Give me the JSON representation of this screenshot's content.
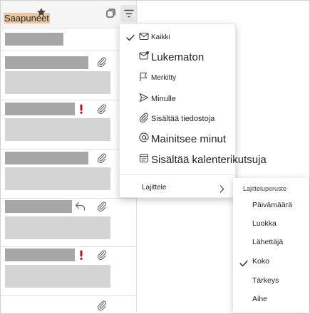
{
  "header": {
    "folder_title": "Saapuneet"
  },
  "filter_menu": {
    "items": [
      {
        "label": "Kaikki",
        "checked": true,
        "icon": "envelope-icon"
      },
      {
        "label": "Lukematon",
        "checked": false,
        "icon": "unread-envelope-icon"
      },
      {
        "label": "Merkitty",
        "checked": false,
        "icon": "flag-icon"
      },
      {
        "label": "Minulle",
        "checked": false,
        "icon": "send-icon"
      },
      {
        "label": "Sisältää tiedostoja",
        "checked": false,
        "icon": "paperclip-icon"
      },
      {
        "label": "Mainitsee minut",
        "checked": false,
        "icon": "at-sign-icon"
      },
      {
        "label": "Sisältää kalenterikutsuja",
        "checked": false,
        "icon": "calendar-icon"
      }
    ],
    "sort_label": "Lajittele"
  },
  "sort_submenu": {
    "header": "Lajitteluperuste",
    "items": [
      {
        "label": "Päivämäärä",
        "checked": false
      },
      {
        "label": "Luokka",
        "checked": false
      },
      {
        "label": "Lähettäjä",
        "checked": false
      },
      {
        "label": "Koko",
        "checked": true
      },
      {
        "label": "Tärkeys",
        "checked": false
      },
      {
        "label": "Aihe",
        "checked": false
      }
    ]
  },
  "message_rows": [
    {
      "icons": []
    },
    {
      "icons": [
        "paperclip-icon"
      ]
    },
    {
      "icons": [
        "important-icon",
        "paperclip-icon"
      ]
    },
    {
      "icons": [
        "paperclip-icon"
      ]
    },
    {
      "icons": [
        "reply-icon",
        "paperclip-icon"
      ]
    },
    {
      "icons": [
        "important-icon",
        "paperclip-icon"
      ]
    },
    {
      "icons": [
        "paperclip-icon"
      ]
    }
  ],
  "colors": {
    "important": "#c50f1f",
    "placeholder_dark": "#a6a6a6",
    "placeholder_light": "#d4d4d4"
  }
}
